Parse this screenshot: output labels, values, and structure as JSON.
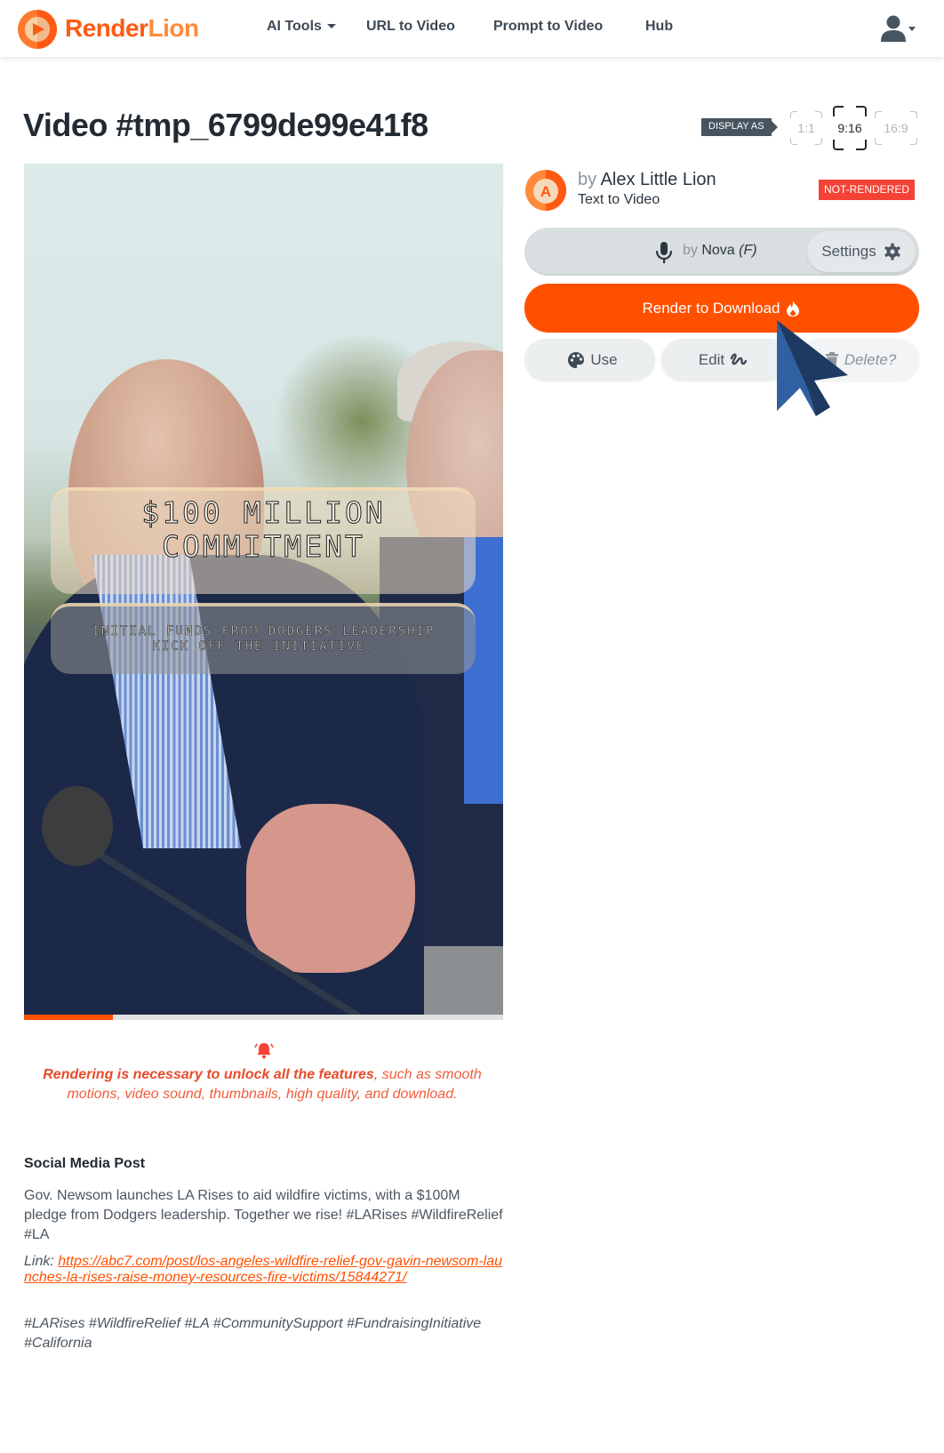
{
  "brand": {
    "name_part1": "Render",
    "name_part2": "Lion",
    "primary_color": "#ff5000",
    "secondary_color": "#ff8a3a"
  },
  "nav": {
    "items": [
      {
        "label": "AI Tools",
        "has_dropdown": true
      },
      {
        "label": "URL to Video"
      },
      {
        "label": "Prompt to Video"
      },
      {
        "label": "Hub"
      }
    ],
    "user_menu_icon": "user-icon"
  },
  "page": {
    "title": "Video #tmp_6799de99e41f8"
  },
  "display": {
    "label": "DISPLAY AS",
    "ratios": [
      {
        "label": "1:1",
        "active": false
      },
      {
        "label": "9:16",
        "active": true
      },
      {
        "label": "16:9",
        "active": false
      }
    ]
  },
  "video": {
    "caption_title_line1": "$100 MILLION",
    "caption_title_line2": "COMMITMENT",
    "caption_sub_line1": "INITIAL FUNDS FROM DODGERS LEADERSHIP",
    "caption_sub_line2": "KICK OFF THE INITIATIVE.",
    "progress_percent": 18.5
  },
  "notice": {
    "icon": "bell-icon",
    "bold": "Rendering is necessary to unlock all the features",
    "rest": ", such as smooth motions, video sound, thumbnails, high quality, and download."
  },
  "social_post": {
    "title": "Social Media Post",
    "body": "Gov. Newsom launches LA Rises to aid wildfire victims, with a $100M pledge from Dodgers leadership. Together we rise! #LARises #WildfireRelief #LA",
    "link_label": "Link: ",
    "link_url": "https://abc7.com/post/los-angeles-wildfire-relief-gov-gavin-newsom-launches-la-rises-raise-money-resources-fire-victims/15844271/",
    "hashtags": "#LARises #WildfireRelief #LA #CommunitySupport #FundraisingInitiative #California"
  },
  "panel": {
    "author_prefix": "by ",
    "author_name": "Alex Little Lion",
    "avatar_letter": "A",
    "kind": "Text to Video",
    "status_badge": "NOT-RENDERED",
    "status_color": "#f44336",
    "voice_prefix": "by ",
    "voice_name": "Nova",
    "voice_gender": "(F)",
    "settings_label": "Settings",
    "render_label": "Render to Download",
    "use_label": "Use",
    "edit_label": "Edit",
    "delete_label": "Delete?"
  }
}
